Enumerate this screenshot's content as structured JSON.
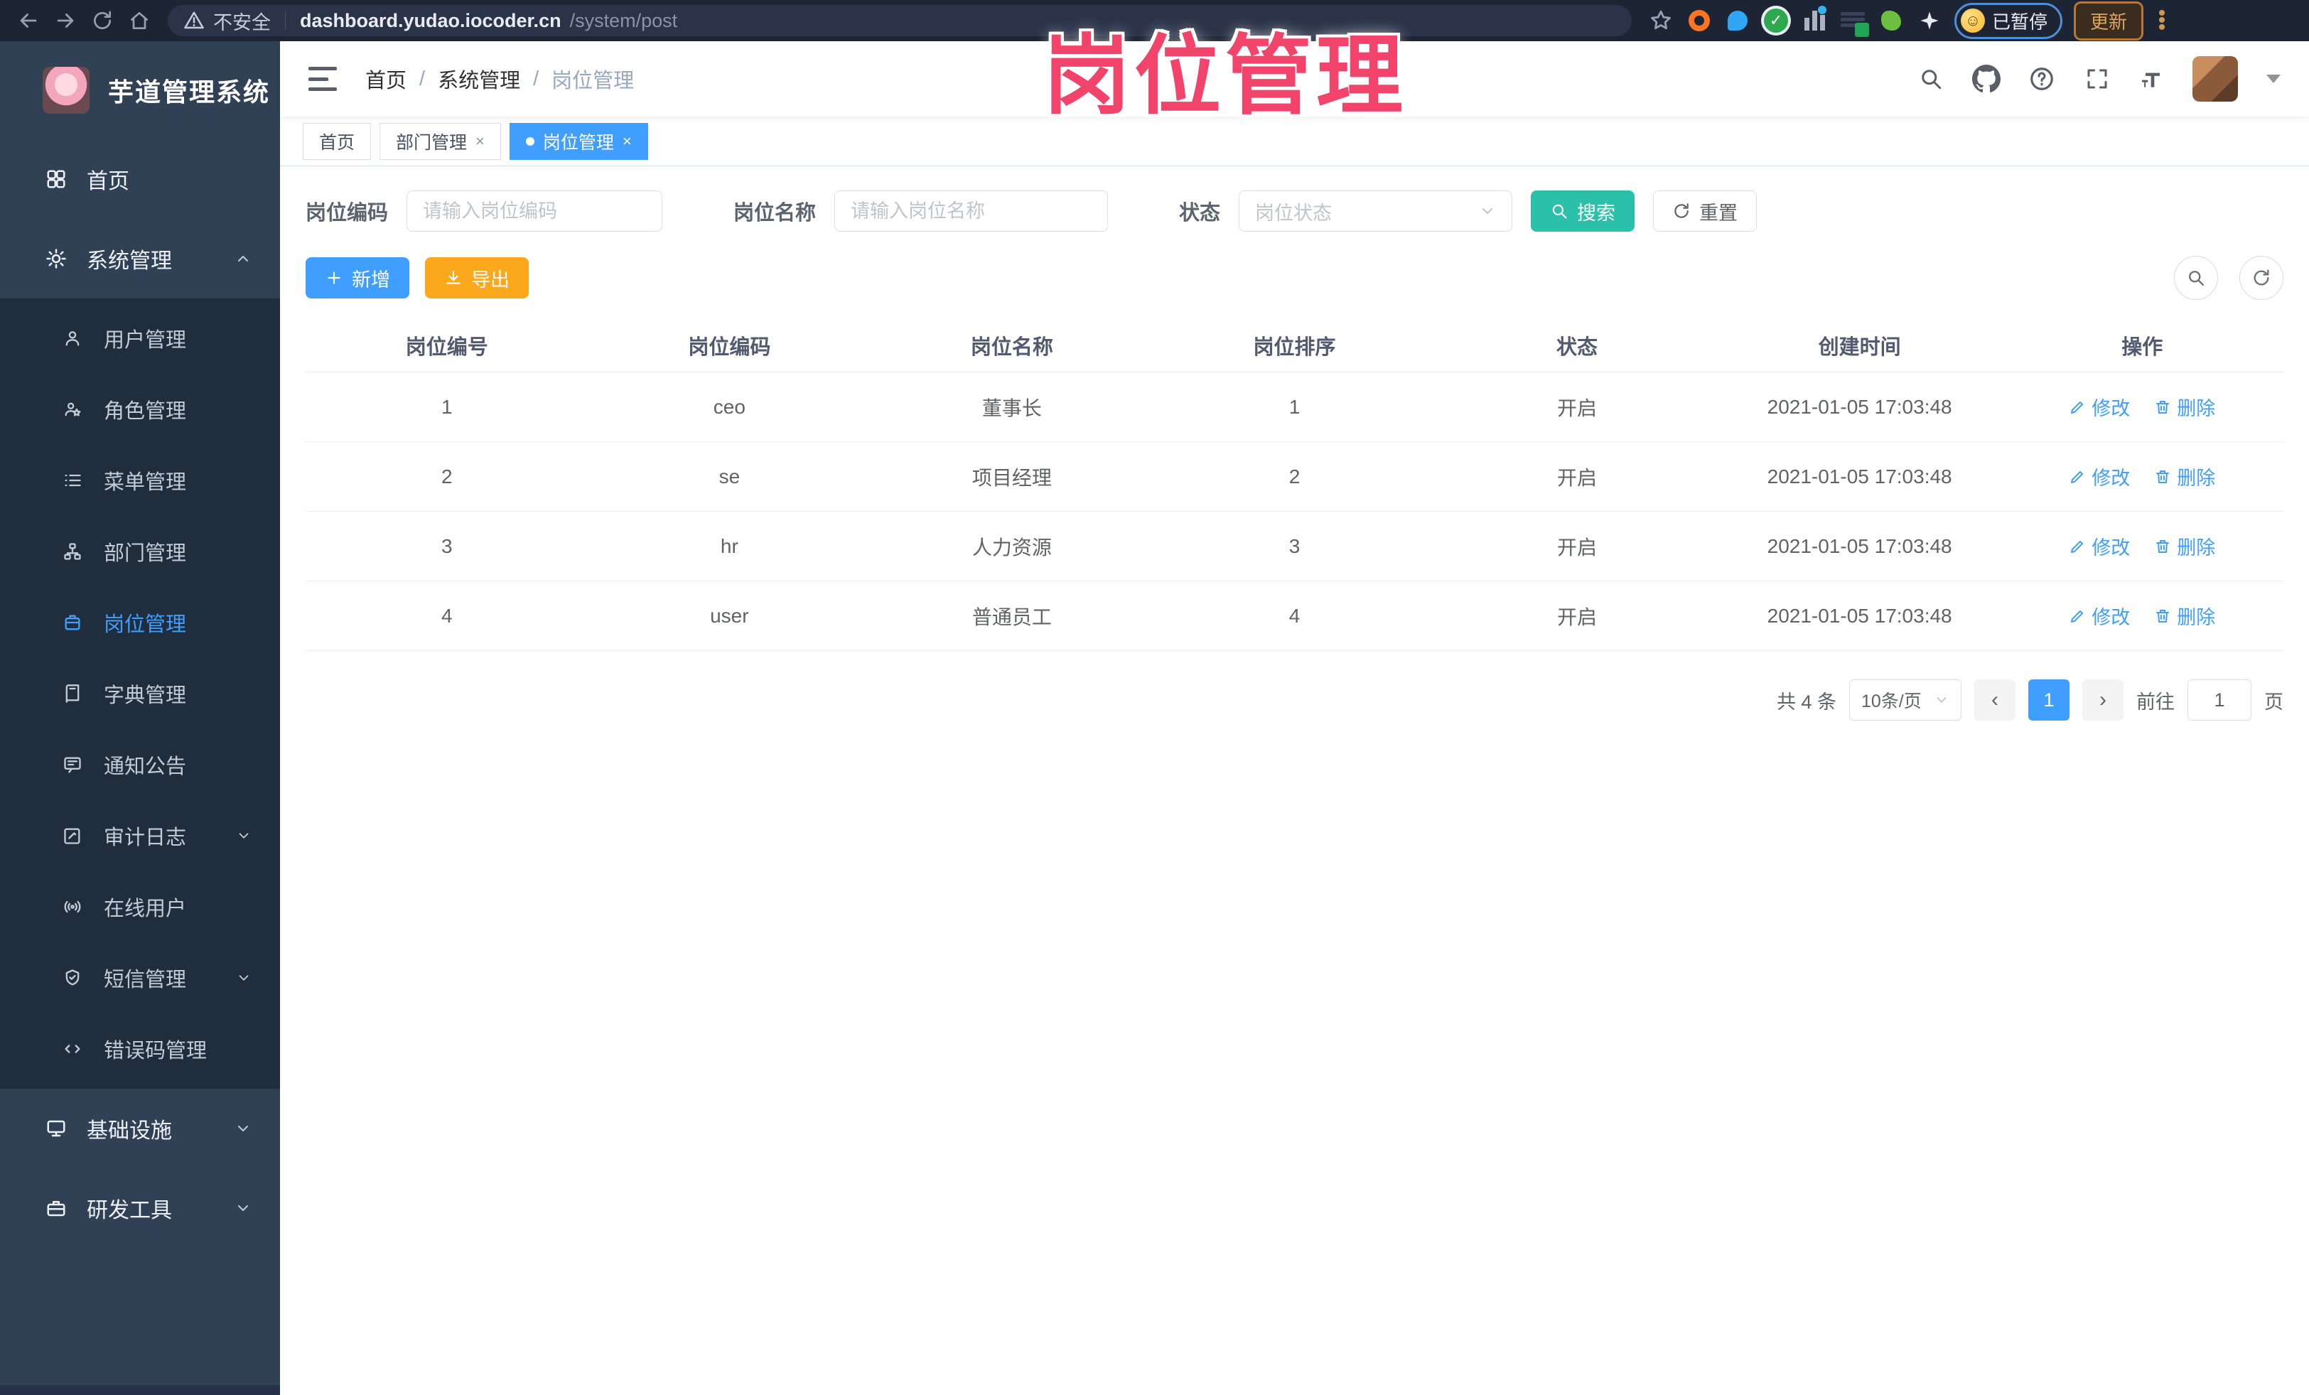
{
  "browser": {
    "security_label": "不安全",
    "url_host": "dashboard.yudao.iocoder.cn",
    "url_path": "/system/post",
    "paused_badge": "已暂停",
    "update_button": "更新"
  },
  "watermark": "岗位管理",
  "sidebar": {
    "app_title": "芋道管理系统",
    "items": [
      {
        "label": "首页"
      },
      {
        "label": "系统管理"
      },
      {
        "label": "用户管理"
      },
      {
        "label": "角色管理"
      },
      {
        "label": "菜单管理"
      },
      {
        "label": "部门管理"
      },
      {
        "label": "岗位管理"
      },
      {
        "label": "字典管理"
      },
      {
        "label": "通知公告"
      },
      {
        "label": "审计日志"
      },
      {
        "label": "在线用户"
      },
      {
        "label": "短信管理"
      },
      {
        "label": "错误码管理"
      },
      {
        "label": "基础设施"
      },
      {
        "label": "研发工具"
      }
    ]
  },
  "breadcrumb": {
    "items": [
      "首页",
      "系统管理",
      "岗位管理"
    ]
  },
  "tabs": [
    {
      "label": "首页"
    },
    {
      "label": "部门管理"
    },
    {
      "label": "岗位管理"
    }
  ],
  "filters": {
    "post_code_label": "岗位编码",
    "post_code_placeholder": "请输入岗位编码",
    "post_name_label": "岗位名称",
    "post_name_placeholder": "请输入岗位名称",
    "status_label": "状态",
    "status_placeholder": "岗位状态",
    "search_button": "搜索",
    "reset_button": "重置"
  },
  "toolbar": {
    "add_button": "新增",
    "export_button": "导出"
  },
  "table": {
    "headers": [
      "岗位编号",
      "岗位编码",
      "岗位名称",
      "岗位排序",
      "状态",
      "创建时间",
      "操作"
    ],
    "edit_label": "修改",
    "delete_label": "删除",
    "rows": [
      {
        "id": "1",
        "code": "ceo",
        "name": "董事长",
        "sort": "1",
        "status": "开启",
        "created": "2021-01-05 17:03:48"
      },
      {
        "id": "2",
        "code": "se",
        "name": "项目经理",
        "sort": "2",
        "status": "开启",
        "created": "2021-01-05 17:03:48"
      },
      {
        "id": "3",
        "code": "hr",
        "name": "人力资源",
        "sort": "3",
        "status": "开启",
        "created": "2021-01-05 17:03:48"
      },
      {
        "id": "4",
        "code": "user",
        "name": "普通员工",
        "sort": "4",
        "status": "开启",
        "created": "2021-01-05 17:03:48"
      }
    ]
  },
  "pagination": {
    "total": "共 4 条",
    "page_size": "10条/页",
    "current_page": "1",
    "goto_prefix": "前往",
    "goto_value": "1",
    "goto_suffix": "页"
  },
  "colors": {
    "accent_blue": "#409EFF",
    "teal": "#2BC0A9",
    "amber": "#FBA81C",
    "sidebar_bg": "#304156",
    "submenu_bg": "#1f2d3d",
    "watermark_pink": "#f2436b",
    "chrome_bg": "#1d2433"
  }
}
